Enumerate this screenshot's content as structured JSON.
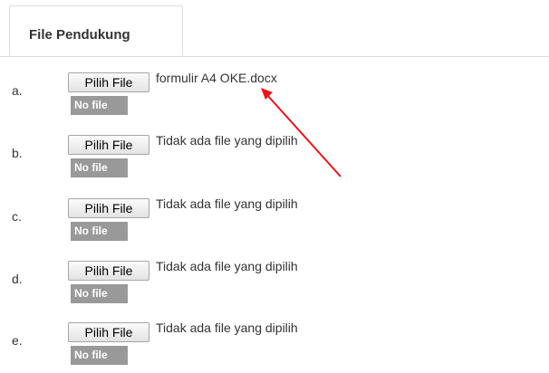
{
  "tab": {
    "label": "File Pendukung"
  },
  "rows": [
    {
      "letter": "a.",
      "button_label": "Pilih File",
      "file_text": "formulir A4 OKE.docx",
      "badge": "No file"
    },
    {
      "letter": "b.",
      "button_label": "Pilih File",
      "file_text": "Tidak ada file yang dipilih",
      "badge": "No file"
    },
    {
      "letter": "c.",
      "button_label": "Pilih File",
      "file_text": "Tidak ada file yang dipilih",
      "badge": "No file"
    },
    {
      "letter": "d.",
      "button_label": "Pilih File",
      "file_text": "Tidak ada file yang dipilih",
      "badge": "No file"
    },
    {
      "letter": "e.",
      "button_label": "Pilih File",
      "file_text": "Tidak ada file yang dipilih",
      "badge": "No file"
    }
  ],
  "annotation": {
    "arrow_color": "#e8141b"
  },
  "colors": {
    "badge_bg": "#999999",
    "tab_border": "#dddddd"
  }
}
